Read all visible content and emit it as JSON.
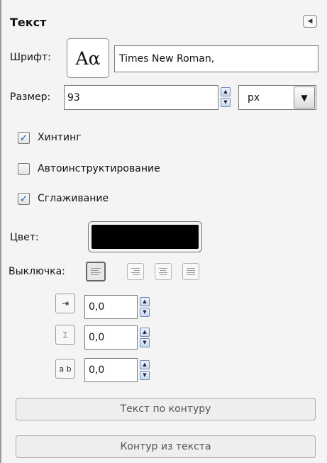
{
  "panel": {
    "title": "Текст",
    "collapse_icon": "left-arrow-icon"
  },
  "font": {
    "label": "Шрифт:",
    "button_glyph": "Aα",
    "value": "Times New Roman,"
  },
  "size": {
    "label": "Размер:",
    "value": "93",
    "unit": "px"
  },
  "options": {
    "hinting": {
      "label": "Хинтинг",
      "checked": true
    },
    "autohint": {
      "label": "Автоинструктирование",
      "checked": false
    },
    "antialias": {
      "label": "Сглаживание",
      "checked": true
    },
    "check_mark": "✓"
  },
  "color": {
    "label": "Цвет:",
    "value": "#000000"
  },
  "justify": {
    "label": "Выключка:",
    "options": [
      "left",
      "right",
      "center",
      "fill"
    ],
    "selected": "left"
  },
  "indent": {
    "value": "0,0",
    "icon": "indent-icon"
  },
  "line_spacing": {
    "value": "0,0",
    "icon": "line-spacing-icon"
  },
  "letter_spacing": {
    "value": "0,0",
    "icon": "letter-spacing-icon",
    "glyph": "a b"
  },
  "buttons": {
    "text_along_path": "Текст по контуру",
    "path_from_text": "Контур из текста"
  },
  "accent_color": "#2f5fbf"
}
